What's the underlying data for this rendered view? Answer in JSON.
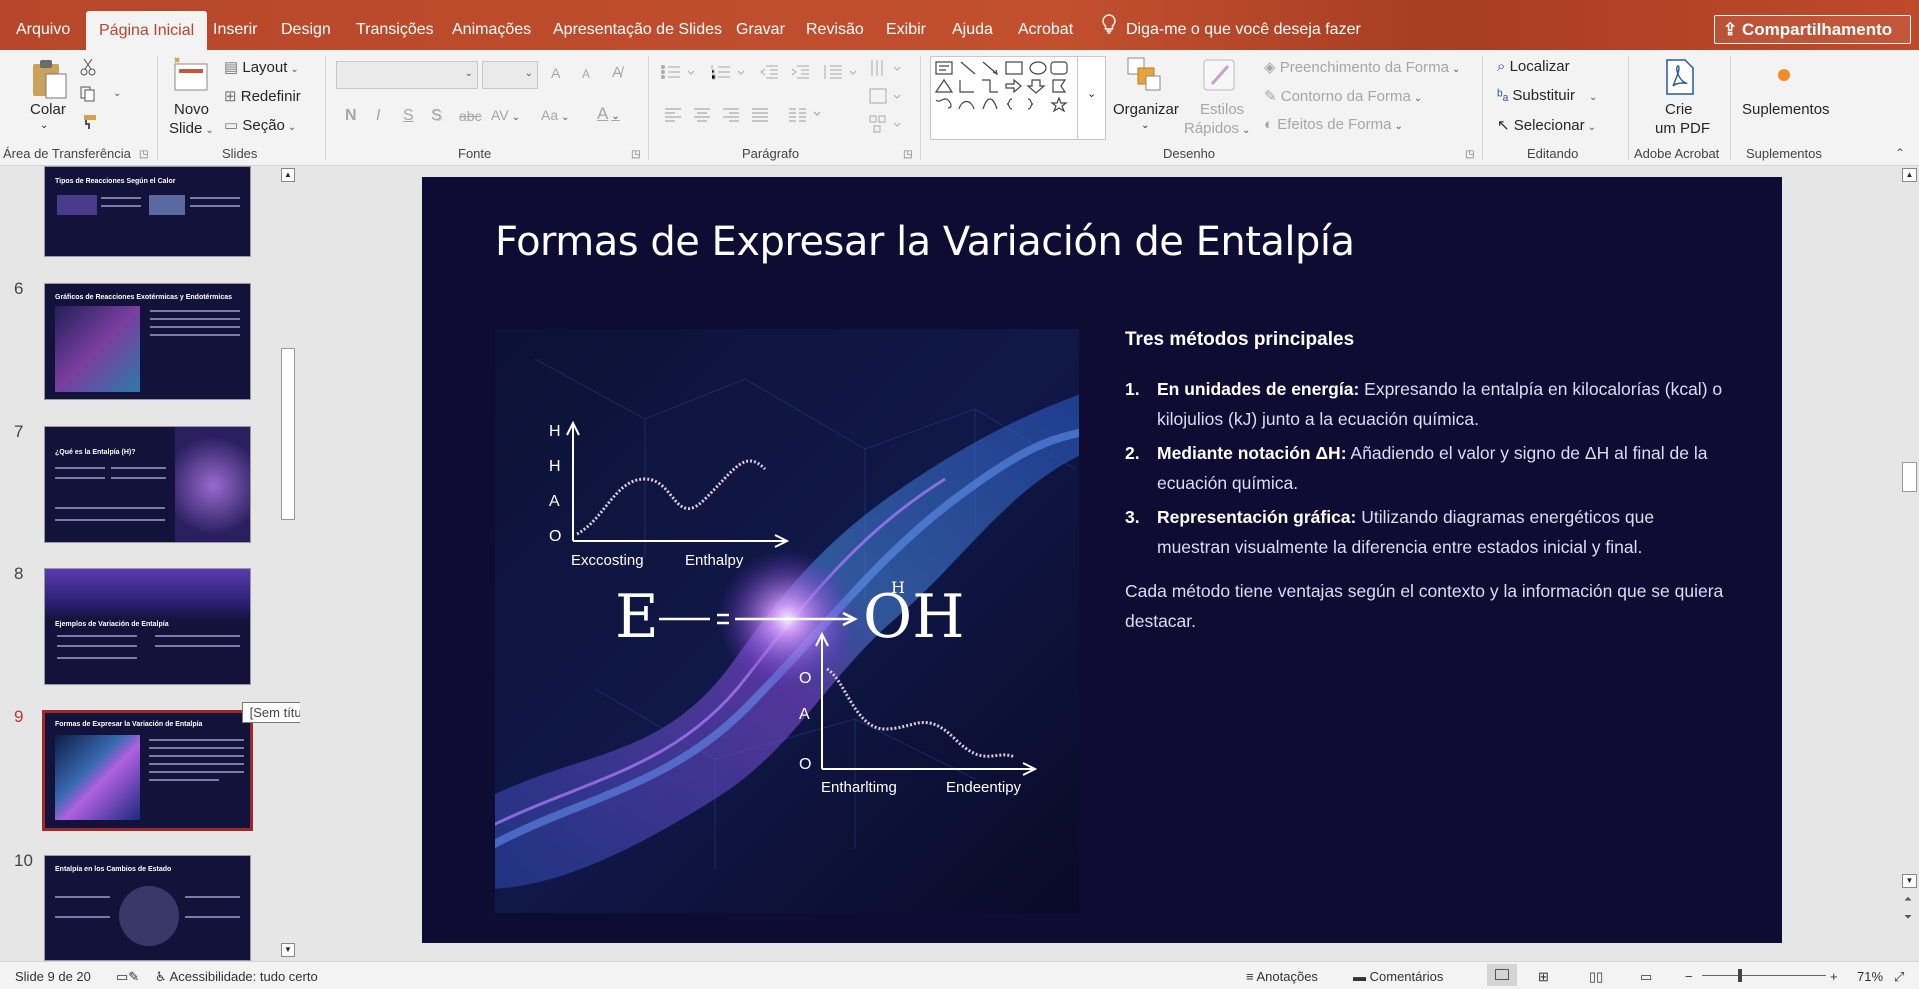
{
  "tabs": [
    "Arquivo",
    "Página Inicial",
    "Inserir",
    "Design",
    "Transições",
    "Animações",
    "Apresentação de Slides",
    "Gravar",
    "Revisão",
    "Exibir",
    "Ajuda",
    "Acrobat"
  ],
  "active_tab": "Página Inicial",
  "tell_me": "Diga-me o que você deseja fazer",
  "share_label": "Compartilhamento",
  "ribbon": {
    "clipboard": {
      "paste": "Colar",
      "label": "Área de Transferência"
    },
    "slides": {
      "new_slide_1": "Novo",
      "new_slide_2": "Slide",
      "layout": "Layout",
      "reset": "Redefinir",
      "section": "Seção",
      "label": "Slides"
    },
    "font": {
      "label": "Fonte",
      "bold": "N",
      "italic": "I",
      "underline": "S",
      "shadow": "S",
      "strike": "abc",
      "spacing": "AV",
      "case": "Aa",
      "grow": "A",
      "shrink": "A",
      "color": "A"
    },
    "paragraph": {
      "label": "Parágrafo"
    },
    "drawing": {
      "arrange": "Organizar",
      "quick_styles_1": "Estilos",
      "quick_styles_2": "Rápidos",
      "fill": "Preenchimento da Forma",
      "outline": "Contorno da Forma",
      "effects": "Efeitos de Forma",
      "label": "Desenho"
    },
    "editing": {
      "find": "Localizar",
      "replace": "Substituir",
      "select": "Selecionar",
      "label": "Editando"
    },
    "acrobat": {
      "create_pdf_1": "Crie",
      "create_pdf_2": "um PDF",
      "label": "Adobe Acrobat"
    },
    "addins": {
      "addins": "Suplementos",
      "label": "Suplementos"
    }
  },
  "thumbnails": [
    {
      "num": "",
      "title": "Tipos de Reacciones Según el Calor"
    },
    {
      "num": "6",
      "title": "Gráficos de Reacciones Exotérmicas y Endotérmicas"
    },
    {
      "num": "7",
      "title": "¿Qué es la Entalpía (H)?"
    },
    {
      "num": "8",
      "title": "Ejemplos de Variación de Entalpía"
    },
    {
      "num": "9",
      "title": "Formas de Expresar la Variación de Entalpía"
    },
    {
      "num": "10",
      "title": "Entalpía en los Cambios de Estado"
    }
  ],
  "tooltip": "[Sem título]",
  "slide": {
    "title": "Formas de Expresar la Variación de Entalpía",
    "subtitle": "Tres métodos principales",
    "items": [
      {
        "num": "1.",
        "bold": "En unidades de energía:",
        "text": " Expresando la entalpía en kilocalorías (kcal) o kilojulios (kJ) junto a la ecuación química."
      },
      {
        "num": "2.",
        "bold": "Mediante notación ΔH:",
        "text": " Añadiendo el valor y signo de ΔH al final de la ecuación química."
      },
      {
        "num": "3.",
        "bold": "Representación gráfica:",
        "text": " Utilizando diagramas energéticos que muestran visualmente la diferencia entre estados inicial y final."
      }
    ],
    "closing": "Cada método tiene ventajas según el contexto y la información que se quiera destacar.",
    "image_labels": {
      "y_axis_top": [
        "H",
        "H",
        "A",
        "O"
      ],
      "x_axis_top": [
        "Exccosting",
        "Enthalpy"
      ],
      "formula_left": "E",
      "formula_right": "OH",
      "formula_h": "H",
      "y_axis_bottom": [
        "O",
        "A",
        "O"
      ],
      "x_axis_bottom": [
        "Entharltimg",
        "Endeentipy"
      ]
    }
  },
  "status": {
    "slide_counter": "Slide 9 de 20",
    "accessibility": "Acessibilidade: tudo certo",
    "notes": "Anotações",
    "comments": "Comentários",
    "zoom": "71%"
  }
}
